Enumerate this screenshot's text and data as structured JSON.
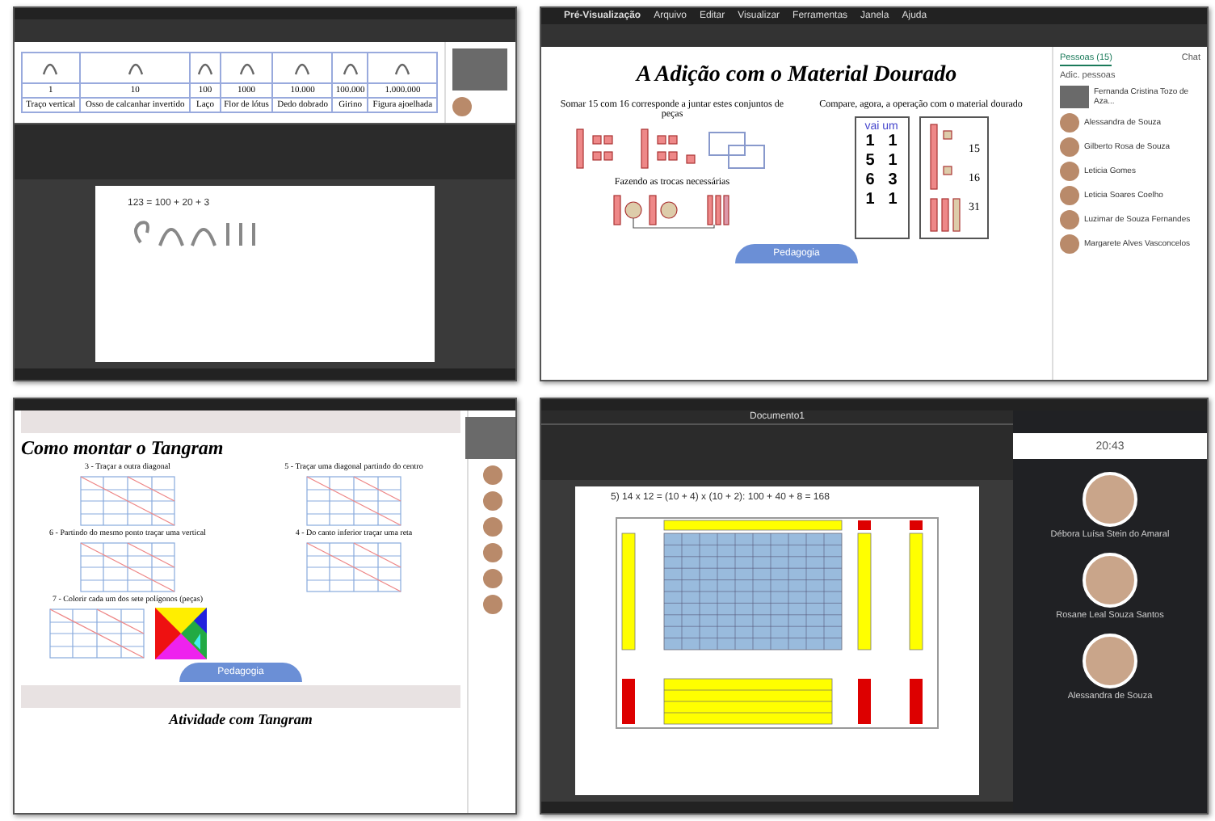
{
  "panels": [
    {
      "kind": "hieroglyph",
      "numbers": [
        "1",
        "10",
        "100",
        "1000",
        "10.000",
        "100.000",
        "1.000.000"
      ],
      "labels": [
        "Traço vertical",
        "Osso de calcanhar invertido",
        "Laço",
        "Flor de lótus",
        "Dedo dobrado",
        "Girino",
        "Figura ajoelhada"
      ],
      "formula": "123 = 100 + 20 + 3"
    },
    {
      "kind": "dourado",
      "menu": [
        "Pré-Visualização",
        "Arquivo",
        "Editar",
        "Visualizar",
        "Ferramentas",
        "Janela",
        "Ajuda"
      ],
      "title": "A Adição com o Material Dourado",
      "left_text": "Somar 15 com 16 corresponde a juntar estes conjuntos de peças",
      "exchange_text": "Fazendo as trocas necessárias",
      "right_text": "Compare, agora, a operação com o material dourado",
      "carry": "vai um",
      "digits": [
        "1",
        "1",
        "5",
        "1",
        "6",
        "3",
        "1",
        "1"
      ],
      "totals": [
        "15",
        "16",
        "31"
      ],
      "badge": "Pedagogia",
      "people_tab": "Pessoas (15)",
      "chat_tab": "Chat",
      "add_people": "Adic. pessoas",
      "participants": [
        "Fernanda Cristina Tozo de Aza...",
        "Alessandra de Souza",
        "Gilberto Rosa de Souza",
        "Leticia Gomes",
        "Leticia Soares Coelho",
        "Luzimar de Souza Fernandes",
        "Margarete Alves Vasconcelos"
      ]
    },
    {
      "kind": "tangram",
      "title": "Como montar o Tangram",
      "steps": [
        "3 - Traçar a outra diagonal",
        "5 - Traçar uma diagonal partindo do centro",
        "6 - Partindo do mesmo ponto traçar uma vertical",
        "4 - Do canto inferior traçar uma reta",
        "7 - Colorir cada um dos sete polígonos (peças)"
      ],
      "badge": "Pedagogia",
      "footer_title": "Atividade com Tangram"
    },
    {
      "kind": "grid",
      "doc_title": "Documento1",
      "formula": "5) 14 x 12 = (10 + 4) x (10 + 2): 100 + 40 + 8 = 168",
      "clock": "20:43",
      "participants": [
        "Débora Luísa Stein do Amaral",
        "Rosane Leal Souza Santos",
        "Alessandra de Souza"
      ]
    }
  ]
}
